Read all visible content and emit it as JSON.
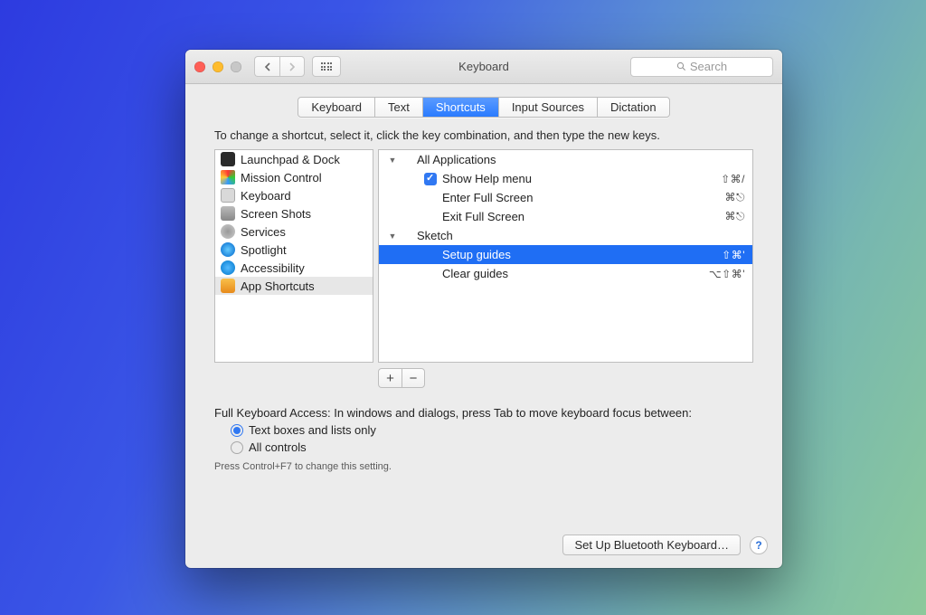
{
  "window": {
    "title": "Keyboard"
  },
  "toolbar": {
    "search_placeholder": "Search"
  },
  "tabs": {
    "items": [
      {
        "label": "Keyboard"
      },
      {
        "label": "Text"
      },
      {
        "label": "Shortcuts"
      },
      {
        "label": "Input Sources"
      },
      {
        "label": "Dictation"
      }
    ],
    "active_index": 2
  },
  "instruction": "To change a shortcut, select it, click the key combination, and then type the new keys.",
  "categories": [
    {
      "label": "Launchpad & Dock",
      "icon": "launchpad"
    },
    {
      "label": "Mission Control",
      "icon": "mission"
    },
    {
      "label": "Keyboard",
      "icon": "keyboard"
    },
    {
      "label": "Screen Shots",
      "icon": "screenshots"
    },
    {
      "label": "Services",
      "icon": "services"
    },
    {
      "label": "Spotlight",
      "icon": "spotlight"
    },
    {
      "label": "Accessibility",
      "icon": "access"
    },
    {
      "label": "App Shortcuts",
      "icon": "app"
    }
  ],
  "categories_selected_index": 7,
  "shortcuts": {
    "groups": [
      {
        "label": "All Applications",
        "items": [
          {
            "label": "Show Help menu",
            "keys": "⇧⌘/",
            "checked": true
          },
          {
            "label": "Enter Full Screen",
            "keys": "⌘⎋",
            "checked": false
          },
          {
            "label": "Exit Full Screen",
            "keys": "⌘⎋",
            "checked": false
          }
        ]
      },
      {
        "label": "Sketch",
        "items": [
          {
            "label": "Setup guides",
            "keys": "⇧⌘'",
            "selected": true
          },
          {
            "label": "Clear guides",
            "keys": "⌥⇧⌘'"
          }
        ]
      }
    ]
  },
  "buttons": {
    "add": "+",
    "remove": "−",
    "bluetooth": "Set Up Bluetooth Keyboard…",
    "help": "?"
  },
  "fka": {
    "heading": "Full Keyboard Access: In windows and dialogs, press Tab to move keyboard focus between:",
    "option1": "Text boxes and lists only",
    "option2": "All controls",
    "hint": "Press Control+F7 to change this setting."
  }
}
